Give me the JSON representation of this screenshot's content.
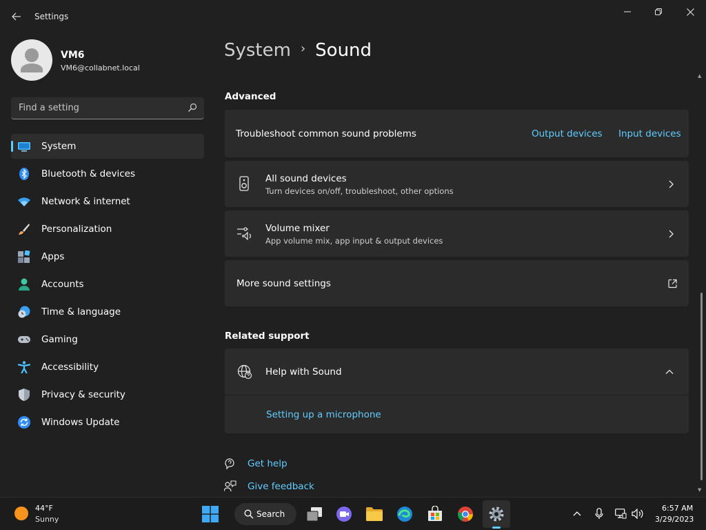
{
  "window": {
    "title": "Settings",
    "back_icon": "arrow-left-icon",
    "minimize_icon": "minimize-icon",
    "maximize_icon": "restore-icon",
    "close_icon": "close-icon"
  },
  "profile": {
    "name": "VM6",
    "email": "VM6@collabnet.local"
  },
  "search": {
    "placeholder": "Find a setting"
  },
  "sidebar": {
    "items": [
      {
        "label": "System",
        "icon": "monitor-icon",
        "active": true
      },
      {
        "label": "Bluetooth & devices",
        "icon": "bluetooth-icon"
      },
      {
        "label": "Network & internet",
        "icon": "wifi-icon"
      },
      {
        "label": "Personalization",
        "icon": "brush-icon"
      },
      {
        "label": "Apps",
        "icon": "apps-icon"
      },
      {
        "label": "Accounts",
        "icon": "person-icon"
      },
      {
        "label": "Time & language",
        "icon": "globe-clock-icon"
      },
      {
        "label": "Gaming",
        "icon": "gamepad-icon"
      },
      {
        "label": "Accessibility",
        "icon": "accessibility-icon"
      },
      {
        "label": "Privacy & security",
        "icon": "shield-icon"
      },
      {
        "label": "Windows Update",
        "icon": "update-icon"
      }
    ]
  },
  "breadcrumb": {
    "parent": "System",
    "separator": "›",
    "current": "Sound"
  },
  "advanced": {
    "title": "Advanced",
    "troubleshoot": {
      "label": "Troubleshoot common sound problems",
      "link_output": "Output devices",
      "link_input": "Input devices"
    },
    "all_devices": {
      "title": "All sound devices",
      "subtitle": "Turn devices on/off, troubleshoot, other options"
    },
    "volume_mixer": {
      "title": "Volume mixer",
      "subtitle": "App volume mix, app input & output devices"
    },
    "more_settings": {
      "title": "More sound settings"
    }
  },
  "related": {
    "title": "Related support",
    "help": {
      "title": "Help with Sound",
      "link": "Setting up a microphone"
    }
  },
  "footer": {
    "get_help": "Get help",
    "give_feedback": "Give feedback"
  },
  "taskbar": {
    "weather_temp": "44°F",
    "weather_desc": "Sunny",
    "search_label": "Search",
    "time": "6:57 AM",
    "date": "3/29/2023"
  },
  "colors": {
    "accent": "#60cdff",
    "background": "#202020",
    "card": "#2b2b2b"
  }
}
